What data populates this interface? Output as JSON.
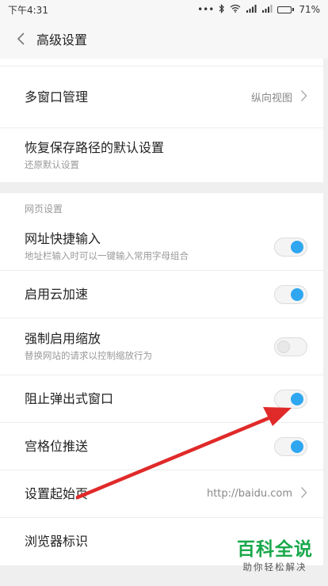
{
  "status_bar": {
    "time": "下午4:31",
    "dots": "•••",
    "bluetooth": "bluetooth-icon",
    "wifi": "wifi-icon",
    "signal1": "signal-icon",
    "signal2": "signal-icon",
    "battery_text": "71%",
    "battery_level": 0.71
  },
  "header": {
    "back_icon": "chevron-left-icon",
    "title": "高级设置"
  },
  "group1": {
    "multiwindow": {
      "title": "多窗口管理",
      "value": "纵向视图"
    },
    "restore_path": {
      "title": "恢复保存路径的默认设置",
      "subtitle": "还原默认设置"
    }
  },
  "web_section": {
    "header": "网页设置",
    "items": [
      {
        "title": "网址快捷输入",
        "subtitle": "地址栏输入时可以一键输入常用字母组合",
        "on": true
      },
      {
        "title": "启用云加速",
        "on": true
      },
      {
        "title": "强制启用缩放",
        "subtitle": "替换网站的请求以控制缩放行为",
        "on": false
      },
      {
        "title": "阻止弹出式窗口",
        "on": true
      },
      {
        "title": "宫格位推送",
        "on": true
      }
    ],
    "homepage": {
      "title": "设置起始页",
      "value": "http://baidu.com"
    },
    "browser_id": {
      "title": "浏览器标识"
    }
  },
  "watermark": {
    "main": "百科全说",
    "sub": "助你轻松解决"
  },
  "colors": {
    "toggle_on": "#2fa7f0",
    "arrow": "#e02a2a",
    "watermark": "#1aa84b"
  }
}
